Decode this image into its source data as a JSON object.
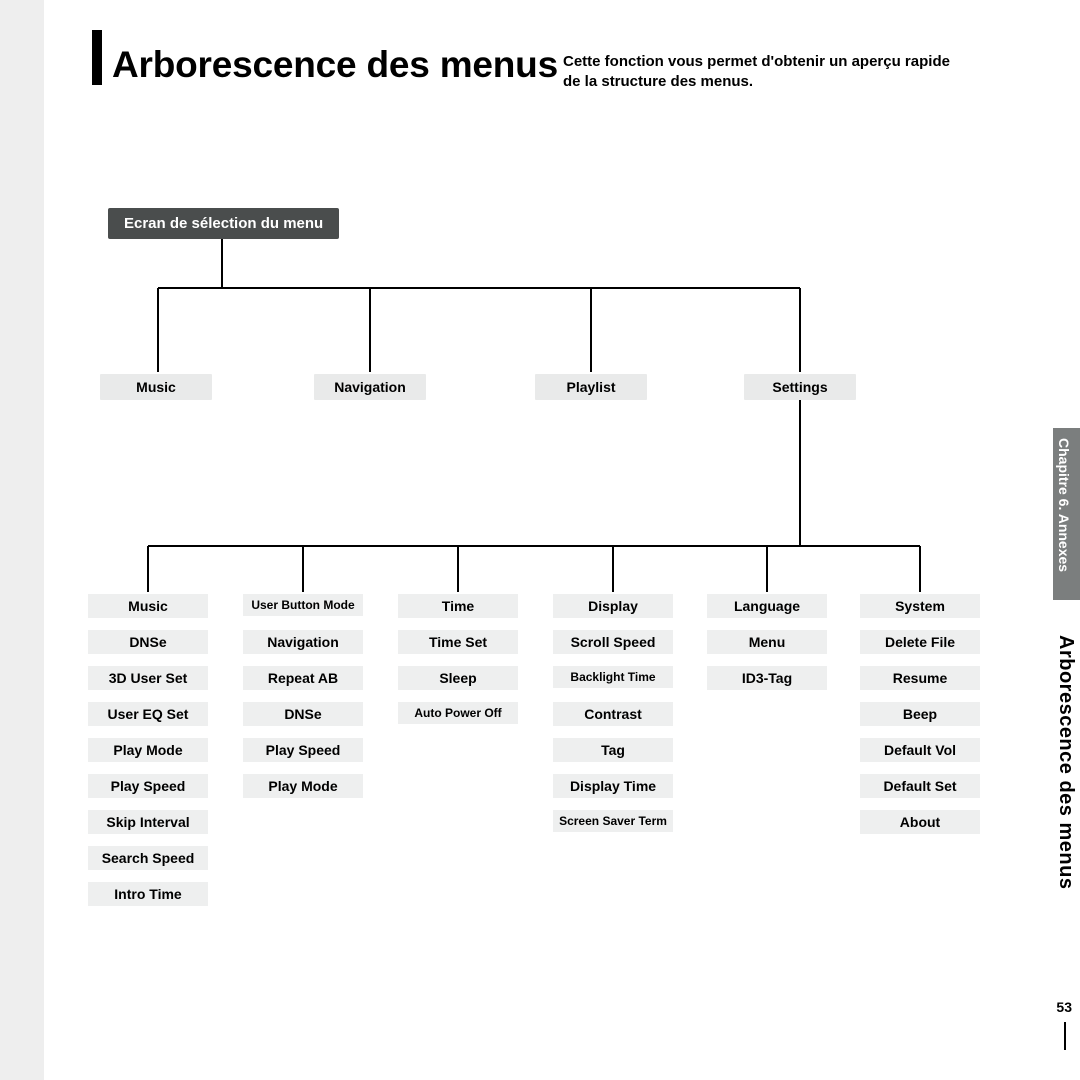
{
  "title": "Arborescence des menus",
  "subtitle": "Cette fonction vous permet d'obtenir un aperçu rapide de la structure des menus.",
  "root": "Ecran de sélection du menu",
  "topMenus": [
    "Music",
    "Navigation",
    "Playlist",
    "Settings"
  ],
  "settingsCols": [
    {
      "header": "Music",
      "items": [
        "DNSe",
        "3D User Set",
        "User EQ Set",
        "Play Mode",
        "Play Speed",
        "Skip Interval",
        "Search Speed",
        "Intro Time"
      ]
    },
    {
      "header": "User Button Mode",
      "items": [
        "Navigation",
        "Repeat AB",
        "DNSe",
        "Play Speed",
        "Play Mode"
      ],
      "smallHeader": true
    },
    {
      "header": "Time",
      "items": [
        "Time Set",
        "Sleep",
        "Auto Power Off"
      ]
    },
    {
      "header": "Display",
      "items": [
        "Scroll Speed",
        "Backlight Time",
        "Contrast",
        "Tag",
        "Display Time",
        "Screen Saver Term"
      ]
    },
    {
      "header": "Language",
      "items": [
        "Menu",
        "ID3-Tag"
      ]
    },
    {
      "header": "System",
      "items": [
        "Delete File",
        "Resume",
        "Beep",
        "Default Vol",
        "Default Set",
        "About"
      ]
    }
  ],
  "chapter": "Chapitre 6. Annexes",
  "sideSection": "Arborescence des menus",
  "pageNumber": "53"
}
